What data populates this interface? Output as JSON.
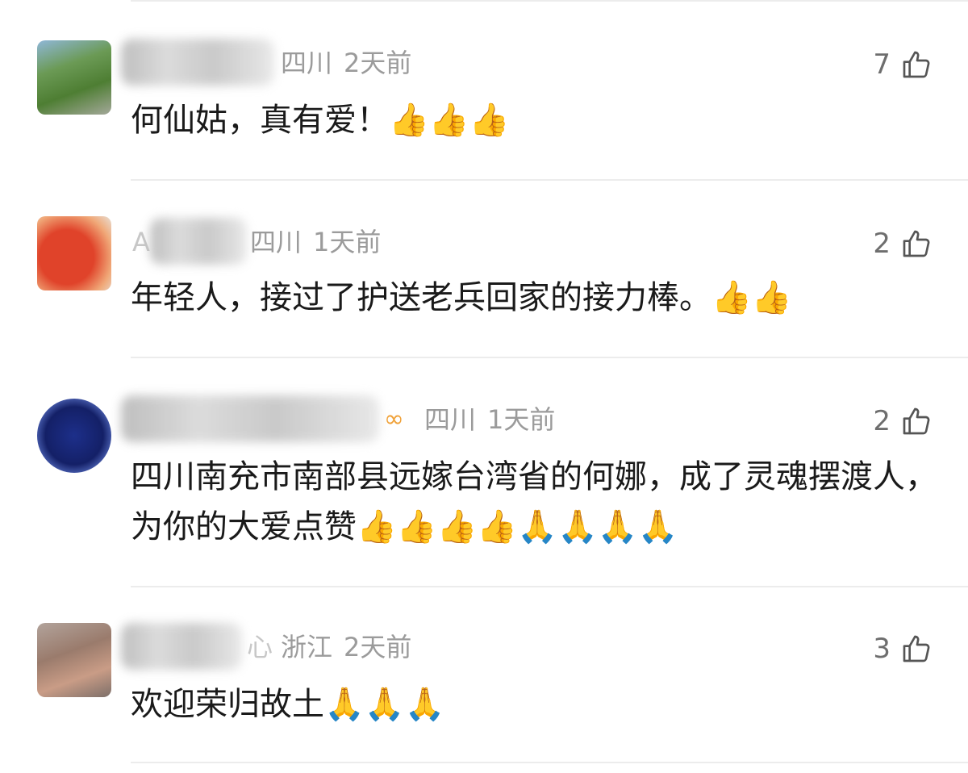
{
  "comments": [
    {
      "location": "四川",
      "time": "2天前",
      "likes": "7",
      "text": "何仙姑，真有爱！👍👍👍",
      "avatar_icon": "user-avatar"
    },
    {
      "name_prefix": "A",
      "location": "四川",
      "time": "1天前",
      "likes": "2",
      "text": "年轻人，接过了护送老兵回家的接力棒。👍👍",
      "avatar_icon": "user-avatar"
    },
    {
      "location": "四川",
      "time": "1天前",
      "likes": "2",
      "badge_icon": "vip-ribbon-icon",
      "text": "四川南充市南部县远嫁台湾省的何娜，成了灵魂摆渡人，为你的大爱点赞👍👍👍👍🙏🙏🙏🙏",
      "avatar_icon": "user-avatar"
    },
    {
      "name_suffix": "心",
      "location": "浙江",
      "time": "2天前",
      "likes": "3",
      "text": "欢迎荣归故土🙏🙏🙏",
      "avatar_icon": "user-avatar"
    }
  ],
  "colors": {
    "meta": "#9b9b9b",
    "text": "#1a1a1a",
    "likes": "#6e6e6e",
    "vip": "#f0a23a"
  }
}
